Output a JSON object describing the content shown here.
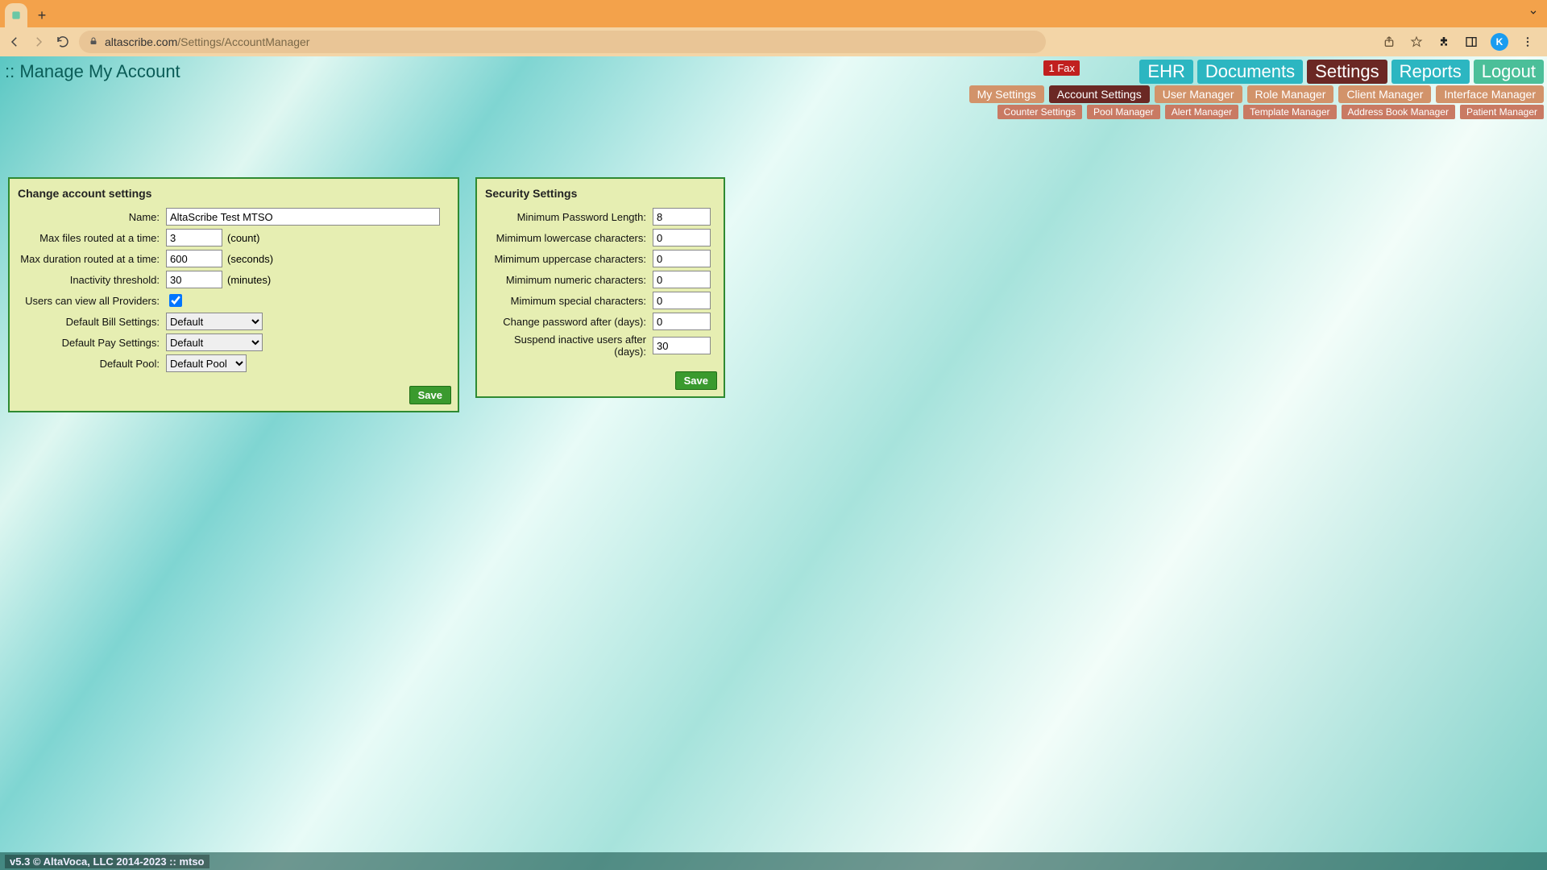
{
  "browser": {
    "url_host": "altascribe.com",
    "url_path": "/Settings/AccountManager",
    "avatar_letter": "K"
  },
  "header": {
    "page_title": ":: Manage My Account",
    "fax_badge": "1 Fax",
    "primary_nav": {
      "ehr": "EHR",
      "documents": "Documents",
      "settings": "Settings",
      "reports": "Reports",
      "logout": "Logout"
    },
    "sub_nav": {
      "my_settings": "My Settings",
      "account_settings": "Account Settings",
      "user_manager": "User Manager",
      "role_manager": "Role Manager",
      "client_manager": "Client Manager",
      "interface_manager": "Interface Manager"
    },
    "sub_sub_nav": {
      "counter_settings": "Counter Settings",
      "pool_manager": "Pool Manager",
      "alert_manager": "Alert Manager",
      "template_manager": "Template Manager",
      "address_book_manager": "Address Book Manager",
      "patient_manager": "Patient Manager"
    }
  },
  "account_panel": {
    "title": "Change account settings",
    "labels": {
      "name": "Name:",
      "max_files": "Max files routed at a time:",
      "max_duration": "Max duration routed at a time:",
      "inactivity": "Inactivity threshold:",
      "view_providers": "Users can view all Providers:",
      "bill_settings": "Default Bill Settings:",
      "pay_settings": "Default Pay Settings:",
      "default_pool": "Default Pool:"
    },
    "suffix": {
      "count": "(count)",
      "seconds": "(seconds)",
      "minutes": "(minutes)"
    },
    "values": {
      "name": "AltaScribe Test MTSO",
      "max_files": "3",
      "max_duration": "600",
      "inactivity": "30",
      "view_providers_checked": true,
      "bill_settings": "Default",
      "pay_settings": "Default",
      "default_pool": "Default Pool"
    },
    "save": "Save"
  },
  "security_panel": {
    "title": "Security Settings",
    "labels": {
      "min_pw_len": "Minimum Password Length:",
      "min_lower": "Mimimum lowercase characters:",
      "min_upper": "Mimimum uppercase characters:",
      "min_numeric": "Mimimum numeric characters:",
      "min_special": "Mimimum special characters:",
      "change_after": "Change password after (days):",
      "suspend_after": "Suspend inactive users after (days):"
    },
    "values": {
      "min_pw_len": "8",
      "min_lower": "0",
      "min_upper": "0",
      "min_numeric": "0",
      "min_special": "0",
      "change_after": "0",
      "suspend_after": "30"
    },
    "save": "Save"
  },
  "footer": {
    "text": "v5.3 © AltaVoca, LLC 2014-2023 :: mtso"
  }
}
